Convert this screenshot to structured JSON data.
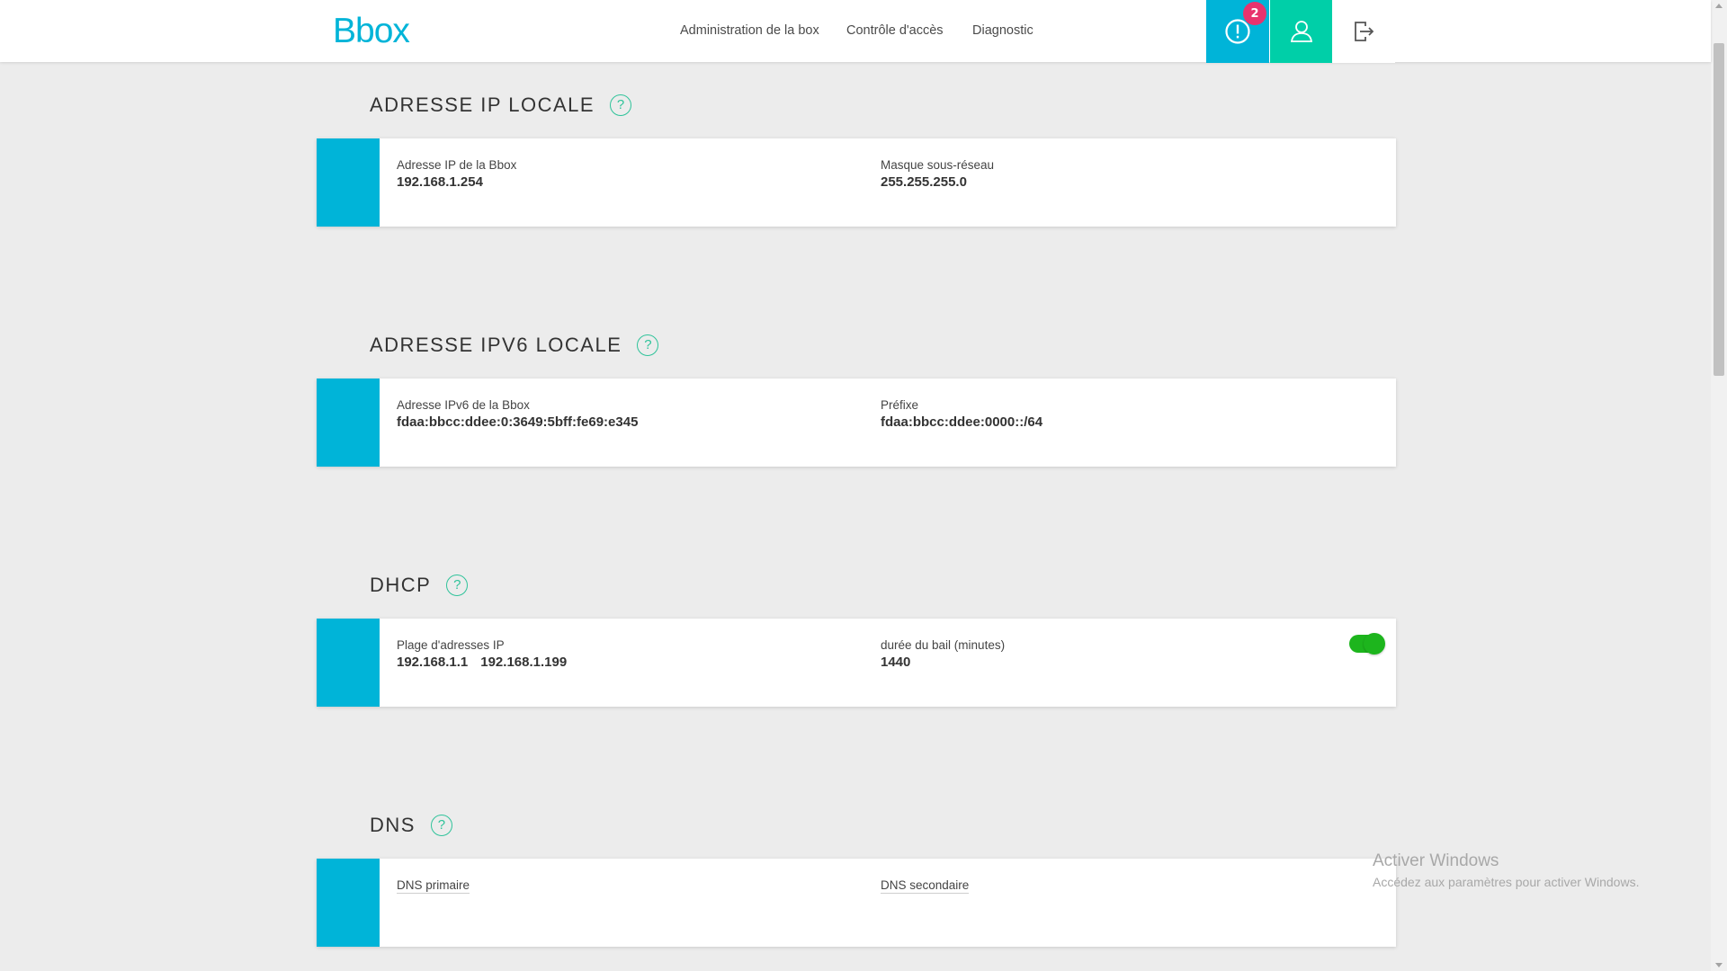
{
  "header": {
    "logo_text": "Bbox",
    "nav": {
      "admin": "Administration de la box",
      "access": "Contrôle d'accès",
      "diagnostic": "Diagnostic"
    },
    "alert_count": "2"
  },
  "sections": {
    "ipv4": {
      "title": "ADRESSE IP LOCALE",
      "help": "?",
      "label1": "Adresse IP de la Bbox",
      "value1": "192.168.1.254",
      "label2": "Masque sous-réseau",
      "value2": "255.255.255.0"
    },
    "ipv6": {
      "title": "ADRESSE IPV6 LOCALE",
      "help": "?",
      "label1": "Adresse IPv6 de la Bbox",
      "value1": "fdaa:bbcc:ddee:0:3649:5bff:fe69:e345",
      "label2": "Préfixe",
      "value2": "fdaa:bbcc:ddee:0000::/64"
    },
    "dhcp": {
      "title": "DHCP",
      "help": "?",
      "label1": "Plage d'adresses IP",
      "range_start": "192.168.1.1",
      "range_end": "192.168.1.199",
      "label2": "durée du bail (minutes)",
      "value2": "1440",
      "enabled": true
    },
    "dns": {
      "title": "DNS",
      "help": "?",
      "label1": "DNS primaire",
      "label2": "DNS secondaire"
    }
  },
  "watermark": {
    "line1": "Activer Windows",
    "line2": "Accédez aux paramètres pour activer Windows."
  },
  "colors": {
    "accent": "#00b4d8",
    "account": "#00cfa8",
    "badge": "#e8336e",
    "toggle_on": "#1db51d",
    "help": "#2fc39a"
  }
}
